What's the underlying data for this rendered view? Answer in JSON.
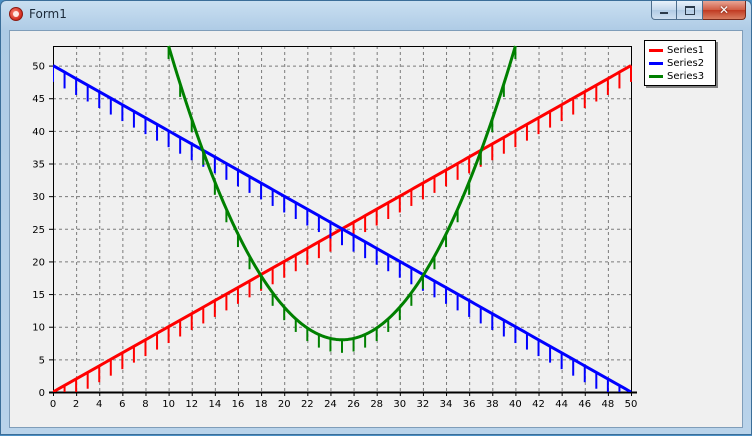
{
  "window": {
    "title": "Form1",
    "icons": {
      "app": "app-icon",
      "minimize": "minimize-icon",
      "maximize": "maximize-icon",
      "close": "close-icon"
    },
    "close_glyph": "✕"
  },
  "chart_data": {
    "type": "line",
    "title": "",
    "xlabel": "",
    "ylabel": "",
    "xlim": [
      0,
      50
    ],
    "ylim": [
      0,
      53
    ],
    "grid": true,
    "legend_position": "top-right outside",
    "x_ticks": [
      0,
      2,
      4,
      6,
      8,
      10,
      12,
      14,
      16,
      18,
      20,
      22,
      24,
      26,
      28,
      30,
      32,
      34,
      36,
      38,
      40,
      42,
      44,
      46,
      48,
      50
    ],
    "y_ticks": [
      0,
      5,
      10,
      15,
      20,
      25,
      30,
      35,
      40,
      45,
      50
    ],
    "series": [
      {
        "name": "Series1",
        "color": "#ff0000",
        "function": "y = x",
        "x_range": [
          0,
          50
        ],
        "error_bar_length": 2.5,
        "error_bar_direction": "down"
      },
      {
        "name": "Series2",
        "color": "#0000ff",
        "function": "y = 50 - x",
        "x_range": [
          0,
          50
        ],
        "error_bar_length": 2.5,
        "error_bar_direction": "down"
      },
      {
        "name": "Series3",
        "color": "#008000",
        "function": "y = 0.2*(x-25)^2 + 8",
        "x_range": [
          10,
          40
        ],
        "error_bar_length": 2.0,
        "error_bar_direction": "down"
      }
    ]
  }
}
